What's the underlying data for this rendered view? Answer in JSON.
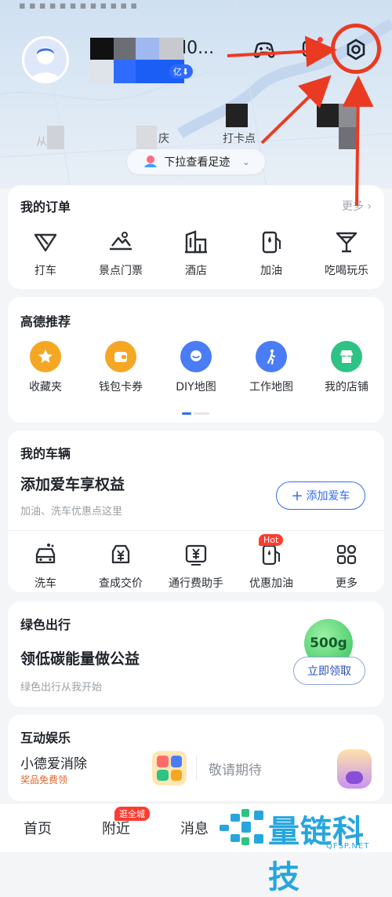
{
  "header": {
    "username_tail": "l0...",
    "badge_text": "亿",
    "stats": [
      {
        "label": "庆"
      },
      {
        "label": "打卡点"
      }
    ],
    "pull_text": "下拉查看足迹",
    "icons": [
      "game-controller-icon",
      "message-icon",
      "settings-icon"
    ]
  },
  "orders": {
    "title": "我的订单",
    "more": "更多",
    "items": [
      {
        "label": "打车",
        "icon": "taxi-icon"
      },
      {
        "label": "景点门票",
        "icon": "scenic-ticket-icon"
      },
      {
        "label": "酒店",
        "icon": "hotel-icon"
      },
      {
        "label": "加油",
        "icon": "fuel-icon"
      },
      {
        "label": "吃喝玩乐",
        "icon": "cocktail-icon"
      }
    ]
  },
  "recommend": {
    "title": "高德推荐",
    "items": [
      {
        "label": "收藏夹",
        "icon": "star-icon",
        "color": "#f5a623"
      },
      {
        "label": "钱包卡券",
        "icon": "wallet-icon",
        "color": "#f5a623"
      },
      {
        "label": "DIY地图",
        "icon": "location-icon",
        "color": "#4a7cf6"
      },
      {
        "label": "工作地图",
        "icon": "walking-icon",
        "color": "#4a7cf6"
      },
      {
        "label": "我的店铺",
        "icon": "shop-icon",
        "color": "#2dc384"
      }
    ]
  },
  "vehicle": {
    "title": "我的车辆",
    "headline": "添加爱车享权益",
    "subline": "加油、洗车优惠点这里",
    "add_button": "添加爱车",
    "items": [
      {
        "label": "洗车",
        "icon": "car-wash-icon"
      },
      {
        "label": "查成交价",
        "icon": "price-tag-icon"
      },
      {
        "label": "通行费助手",
        "icon": "toll-icon"
      },
      {
        "label": "优惠加油",
        "icon": "fuel-discount-icon",
        "badge": "Hot"
      },
      {
        "label": "更多",
        "icon": "grid-icon"
      }
    ]
  },
  "green": {
    "title": "绿色出行",
    "headline": "领低碳能量做公益",
    "subline": "绿色出行从我开始",
    "energy": "500g",
    "claim_button": "立即领取"
  },
  "entertainment": {
    "title": "互动娱乐",
    "game_title": "小德爱消除",
    "game_sub": "奖品免费领",
    "coming_soon": "敬请期待"
  },
  "tabbar": {
    "tabs": [
      "首页",
      "附近",
      "消息"
    ],
    "nearby_badge": "逛全城"
  },
  "watermark": {
    "brand": "量链科技",
    "url": "QFSP.NET"
  },
  "colors": {
    "accent_blue": "#2f6bff",
    "annotation_red": "#ea3b22",
    "hot_red": "#ff3b30",
    "green": "#2dc384"
  }
}
